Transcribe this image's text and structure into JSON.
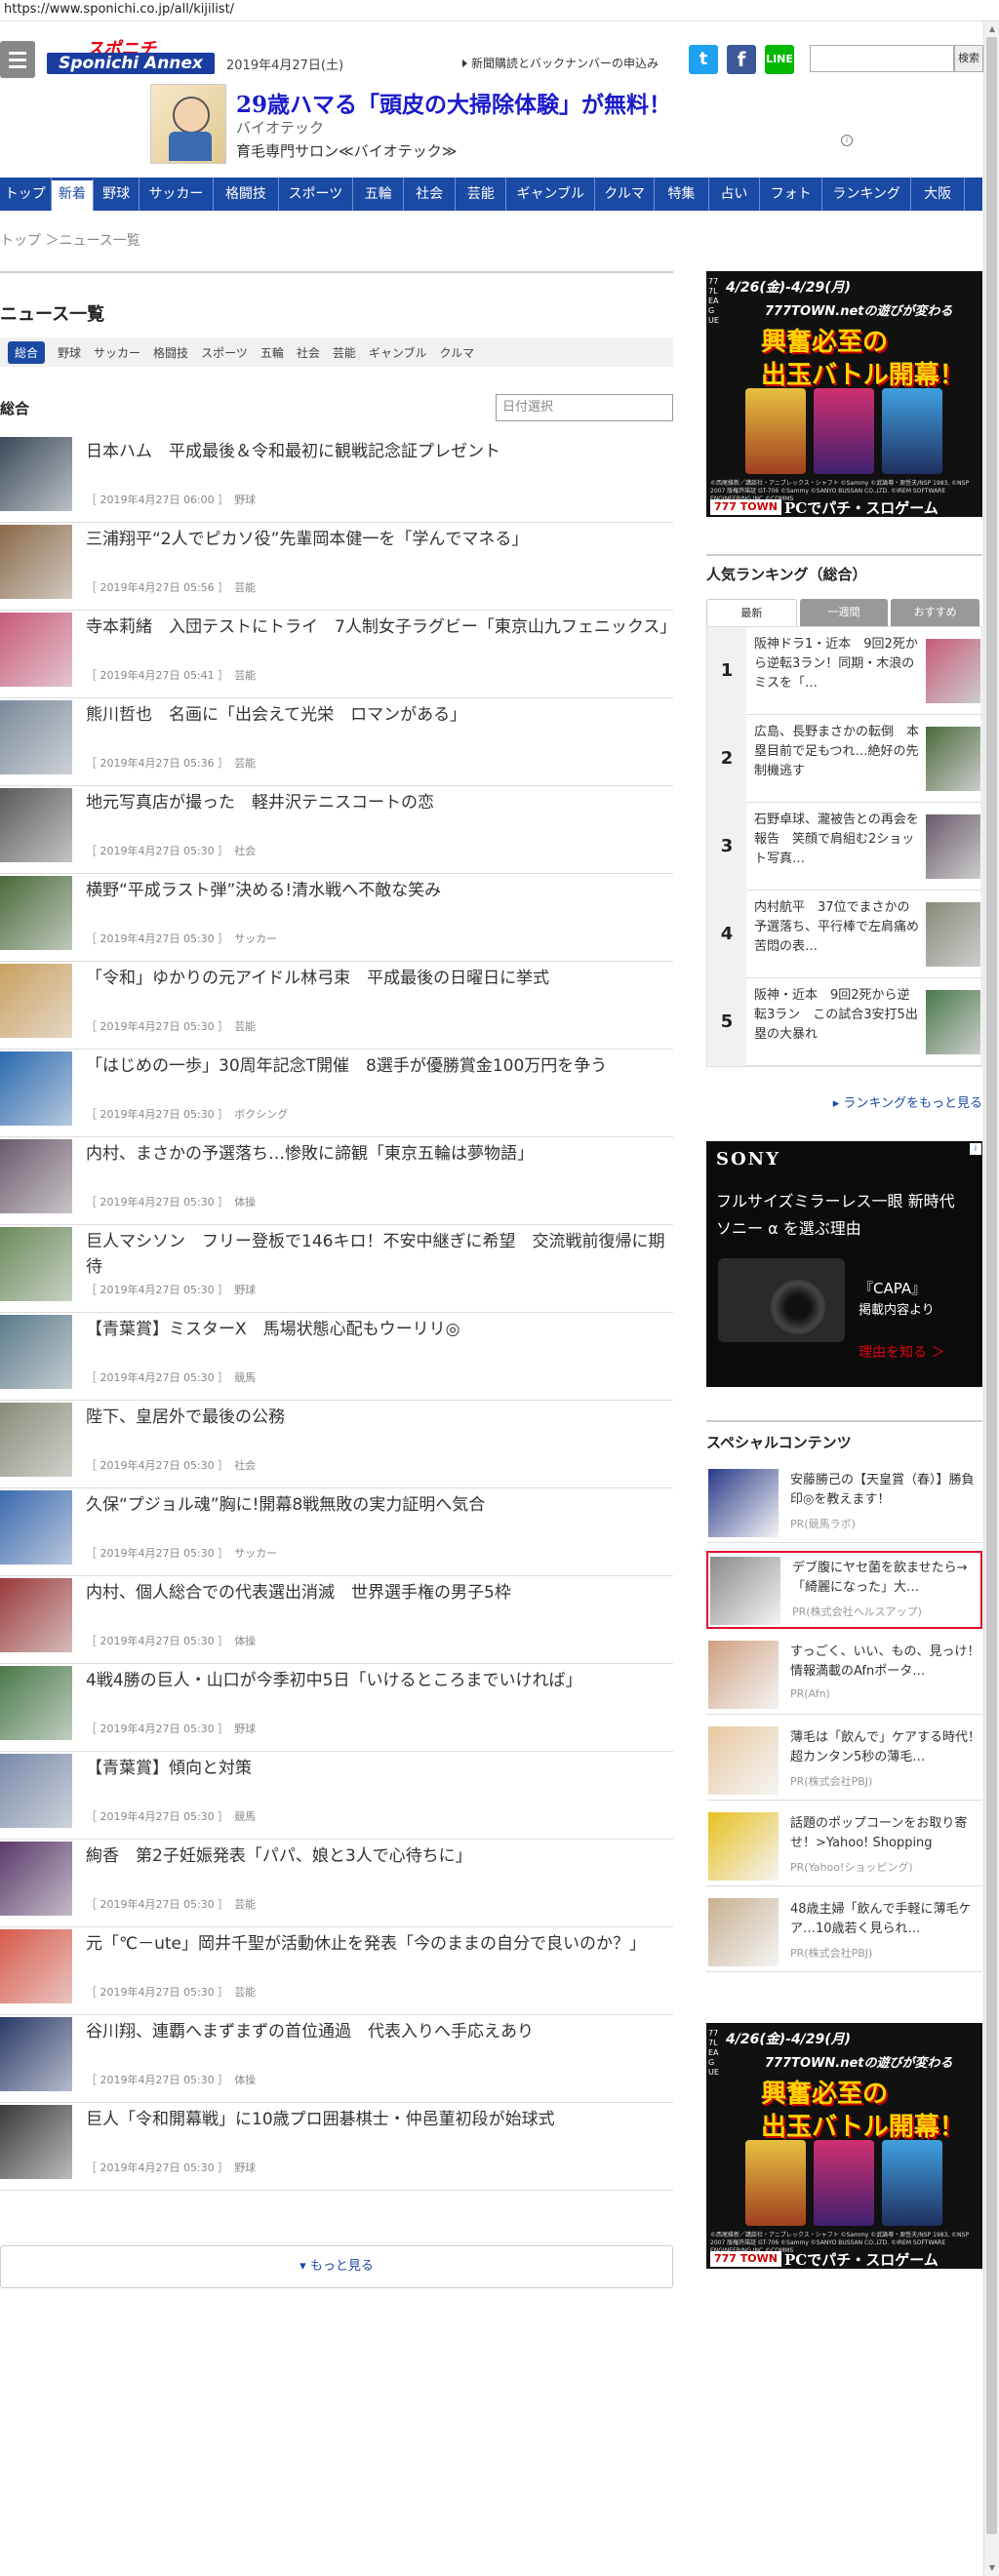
{
  "url": "https://www.sponichi.co.jp/all/kijilist/",
  "header": {
    "logo_top": "スポニチ",
    "logo_main": "Sponichi Annex",
    "date": "2019年4月27日(土)",
    "subscribe": "新聞購読とバックナンバーの申込み",
    "twitter": "t",
    "facebook": "f",
    "line": "LINE",
    "search_button": "検索"
  },
  "ad_top": {
    "title": "29歳ハマる「頭皮の大掃除体験」が無料！",
    "sub": "バイオテック",
    "desc": "育毛専門サロン≪バイオテック≫",
    "info": "i"
  },
  "gnav": [
    "トップ",
    "新着",
    "野球",
    "サッカー",
    "格闘技",
    "スポーツ",
    "五輪",
    "社会",
    "芸能",
    "ギャンブル",
    "クルマ",
    "特集",
    "占い",
    "フォト",
    "ランキング",
    "大阪"
  ],
  "breadcrumb": "トップ ＞ニュース一覧",
  "main": {
    "title": "ニュース一覧",
    "categories": [
      "総合",
      "野球",
      "サッカー",
      "格闘技",
      "スポーツ",
      "五輪",
      "社会",
      "芸能",
      "ギャンブル",
      "クルマ"
    ],
    "section": "総合",
    "date_placeholder": "日付選択",
    "more": "もっと見る"
  },
  "news": [
    {
      "title": "日本ハム　平成最後＆令和最初に観戦記念証プレゼント",
      "date": "［ 2019年4月27日 06:00 ］",
      "cat": "野球"
    },
    {
      "title": "三浦翔平“2人でピカソ役”先輩岡本健一を「学んでマネる」",
      "date": "［ 2019年4月27日 05:56 ］",
      "cat": "芸能"
    },
    {
      "title": "寺本莉緒　入団テストにトライ　7人制女子ラグビー「東京山九フェニックス」",
      "date": "［ 2019年4月27日 05:41 ］",
      "cat": "芸能"
    },
    {
      "title": "熊川哲也　名画に「出会えて光栄　ロマンがある」",
      "date": "［ 2019年4月27日 05:36 ］",
      "cat": "芸能"
    },
    {
      "title": "地元写真店が撮った　軽井沢テニスコートの恋",
      "date": "［ 2019年4月27日 05:30 ］",
      "cat": "社会"
    },
    {
      "title": "横野“平成ラスト弾”決める!清水戦へ不敵な笑み",
      "date": "［ 2019年4月27日 05:30 ］",
      "cat": "サッカー"
    },
    {
      "title": "「令和」ゆかりの元アイドル林弓束　平成最後の日曜日に挙式",
      "date": "［ 2019年4月27日 05:30 ］",
      "cat": "芸能"
    },
    {
      "title": "「はじめの一歩」30周年記念T開催　8選手が優勝賞金100万円を争う",
      "date": "［ 2019年4月27日 05:30 ］",
      "cat": "ボクシング"
    },
    {
      "title": "内村、まさかの予選落ち…惨敗に諦観「東京五輪は夢物語」",
      "date": "［ 2019年4月27日 05:30 ］",
      "cat": "体操"
    },
    {
      "title": "巨人マシソン　フリー登板で146キロ！不安中継ぎに希望　交流戦前復帰に期待",
      "date": "［ 2019年4月27日 05:30 ］",
      "cat": "野球"
    },
    {
      "title": "【青葉賞】ミスターX　馬場状態心配もウーリリ◎",
      "date": "［ 2019年4月27日 05:30 ］",
      "cat": "競馬"
    },
    {
      "title": "陛下、皇居外で最後の公務",
      "date": "［ 2019年4月27日 05:30 ］",
      "cat": "社会"
    },
    {
      "title": "久保“プジョル魂”胸に!開幕8戦無敗の実力証明へ気合",
      "date": "［ 2019年4月27日 05:30 ］",
      "cat": "サッカー"
    },
    {
      "title": "内村、個人総合での代表選出消滅　世界選手権の男子5枠",
      "date": "［ 2019年4月27日 05:30 ］",
      "cat": "体操"
    },
    {
      "title": "4戦4勝の巨人・山口が今季初中5日「いけるところまでいければ」",
      "date": "［ 2019年4月27日 05:30 ］",
      "cat": "野球"
    },
    {
      "title": "【青葉賞】傾向と対策",
      "date": "［ 2019年4月27日 05:30 ］",
      "cat": "競馬"
    },
    {
      "title": "絢香　第2子妊娠発表「パパ、娘と3人で心待ちに」",
      "date": "［ 2019年4月27日 05:30 ］",
      "cat": "芸能"
    },
    {
      "title": "元「℃－ute」岡井千聖が活動休止を発表「今のままの自分で良いのか？」",
      "date": "［ 2019年4月27日 05:30 ］",
      "cat": "芸能"
    },
    {
      "title": "谷川翔、連覇へまずまずの首位通過　代表入りへ手応えあり",
      "date": "［ 2019年4月27日 05:30 ］",
      "cat": "体操"
    },
    {
      "title": "巨人「令和開幕戦」に10歳プロ囲碁棋士・仲邑菫初段が始球式",
      "date": "［ 2019年4月27日 05:30 ］",
      "cat": "野球"
    }
  ],
  "thumb_colors": [
    "#3a4a5a",
    "#8a6a4a",
    "#c85a7a",
    "#7a8a9a",
    "#5a5a5a",
    "#4a6a3a",
    "#caa060",
    "#2a6ab0",
    "#6a5a6a",
    "#6a8a5a",
    "#5a7a8a",
    "#8a8a7a",
    "#3a6ab0",
    "#9a3a3a",
    "#4a7a4a",
    "#7a8aaa",
    "#5a3a6a",
    "#d85a4a",
    "#2a3a6a",
    "#3a3a3a"
  ],
  "banner": {
    "head": "4/26(金)-4/29(月)",
    "line1": "777TOWN.netの遊びが変わる",
    "line2": "興奮必至の",
    "line3": "出玉バトル開幕！",
    "vertical": "777LEAGUE",
    "fine": "©西尾維新／講談社・アニプレックス・シャフト ©Sammy ©武論尊・原哲夫/NSP 1983, ©NSP 2007 版権許諾証 GT-706 ©Sammy ©SANYO BUSSAN CO.,LTD. ©IREM SOFTWARE ENGINEERING INC.©COMMS",
    "bottom_left": "777 TOWN",
    "bottom_right": "PCでパチ・スロゲーム"
  },
  "ranking": {
    "title": "人気ランキング（総合）",
    "tabs": [
      "最新",
      "一週間",
      "おすすめ"
    ],
    "items": [
      {
        "rank": "1",
        "text": "阪神ドラ1・近本　9回2死から逆転3ラン！同期・木浪のミスを「…"
      },
      {
        "rank": "2",
        "text": "広島、長野まさかの転倒　本塁目前で足もつれ…絶好の先制機逃す"
      },
      {
        "rank": "3",
        "text": "石野卓球、瀧被告との再会を報告　笑顔で肩組む2ショット写真…"
      },
      {
        "rank": "4",
        "text": "内村航平　37位でまさかの予選落ち、平行棒で左肩痛め苦悶の表…"
      },
      {
        "rank": "5",
        "text": "阪神・近本　9回2死から逆転3ラン　この試合3安打5出塁の大暴れ"
      }
    ],
    "more": "▸ ランキングをもっと見る"
  },
  "sony_ad": {
    "brand": "SONY",
    "line1": "フルサイズミラーレス一眼 新時代",
    "line2": "ソニー α を選ぶ理由",
    "line3": "『CAPA』",
    "line4": "掲載内容より",
    "line5": "理由を知る ＞",
    "adchoice": "i"
  },
  "special": {
    "title": "スペシャルコンテンツ",
    "items": [
      {
        "text": "安藤勝己の【天皇賞（春）】勝負印◎を教えます！",
        "pr": "PR(競馬ラボ)"
      },
      {
        "text": "デブ腹にヤセ菌を飲ませたら→「綺麗になった」大…",
        "pr": "PR(株式会社ヘルスアップ)"
      },
      {
        "text": "すっごく、いい、もの、見っけ！情報満載のAfnポータ…",
        "pr": "PR(Afn)"
      },
      {
        "text": "薄毛は「飲んで」ケアする時代！超カンタン5秒の薄毛…",
        "pr": "PR(株式会社PBJ)"
      },
      {
        "text": "話題のポップコーンをお取り寄せ！>Yahoo! Shopping",
        "pr": "PR(Yahoo!ショッピング)"
      },
      {
        "text": "48歳主婦「飲んで手軽に薄毛ケア…10歳若く見られ…",
        "pr": "PR(株式会社PBJ)"
      }
    ]
  }
}
